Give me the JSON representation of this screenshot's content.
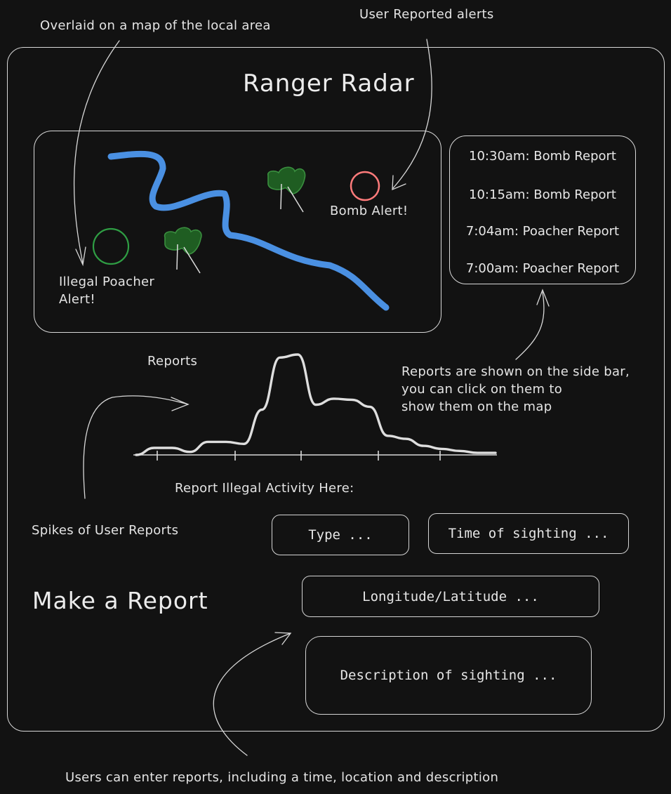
{
  "annotations": {
    "overlay_note": "Overlaid on a map of the local area",
    "alerts_note": "User Reported alerts",
    "sidebar_note_1": "Reports are shown on the side bar,",
    "sidebar_note_2": "you can click on them to",
    "sidebar_note_3": "show them on the map",
    "spikes_note": "Spikes of User Reports",
    "form_note": "Users can enter reports, including a time, location and description"
  },
  "app": {
    "title": "Ranger Radar"
  },
  "map": {
    "river_color": "#4a90e2",
    "tree_color": "#1f5d22",
    "poacher_alert": {
      "line1": "Illegal Poacher",
      "line2": "Alert!",
      "color": "#2f9e44"
    },
    "bomb_alert": {
      "label": "Bomb Alert!",
      "color": "#ff7b7b"
    }
  },
  "sidebar": {
    "items": [
      {
        "label": "10:30am: Bomb Report"
      },
      {
        "label": "10:15am: Bomb Report"
      },
      {
        "label": "7:04am: Poacher Report"
      },
      {
        "label": "7:00am: Poacher Report"
      }
    ]
  },
  "chart_data": {
    "type": "line",
    "title": "Reports",
    "xlabel": "",
    "ylabel": "",
    "series": [
      {
        "values": [
          0.0,
          0.07,
          0.07,
          0.03,
          0.13,
          0.13,
          0.11,
          0.45,
          0.97,
          1.0,
          0.5,
          0.56,
          0.55,
          0.48,
          0.19,
          0.16,
          0.09,
          0.06,
          0.04,
          0.02,
          0.02
        ]
      }
    ]
  },
  "report_form": {
    "heading": "Report Illegal Activity Here:",
    "section_title": "Make a Report",
    "type_placeholder": "Type ...",
    "time_placeholder": "Time of sighting ...",
    "location_placeholder": "Longitude/Latitude ...",
    "description_placeholder": "Description of sighting ..."
  }
}
